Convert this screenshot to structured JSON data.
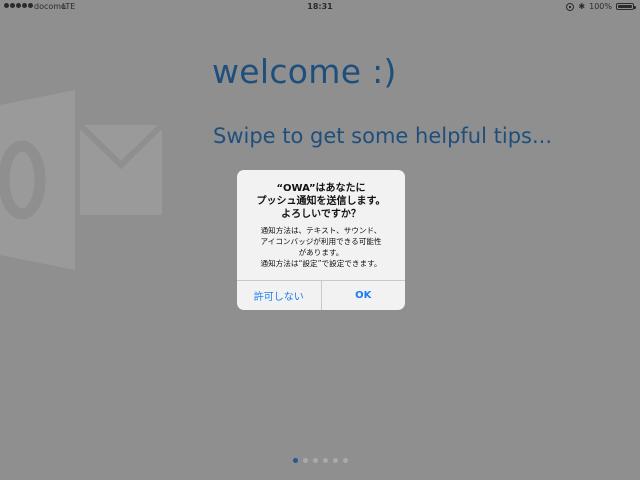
{
  "status_bar": {
    "carrier": "docomo",
    "network": "LTE",
    "time": "18:31",
    "bluetooth_glyph": "✱",
    "battery": "100%",
    "icons": [
      "signal-dots-icon",
      "rotation-lock-icon",
      "bluetooth-icon",
      "battery-icon"
    ]
  },
  "welcome": {
    "title": "welcome :)",
    "subtitle": "Swipe to get some helpful tips..."
  },
  "alert": {
    "title": "“OWA”はあなたに\nプッシュ通知を送信します。\nよろしいですか？",
    "message": "通知方法は、テキスト、サウンド、\nアイコンバッジが利用できる可能性\nがあります。\n通知方法は“設定”で設定できます。",
    "cancel_label": "許可しない",
    "ok_label": "OK"
  },
  "pager": {
    "count": 6,
    "active_index": 0
  },
  "colors": {
    "overlay_background": "#8f8f8f",
    "title_text": "#1e4f7c",
    "alert_button": "#1a7df0",
    "active_dot": "#1e5a96"
  }
}
